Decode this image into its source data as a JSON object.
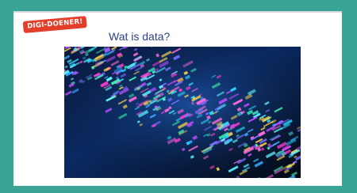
{
  "slide": {
    "badge": "DIGI-DOENER!",
    "title": "Wat is data?"
  },
  "colors": {
    "frame": "#3aa596",
    "badge_background": "#e43e2b",
    "title_text": "#2e3f86",
    "image_background": "#081028"
  },
  "image": {
    "icon": "data-visualization-image"
  }
}
